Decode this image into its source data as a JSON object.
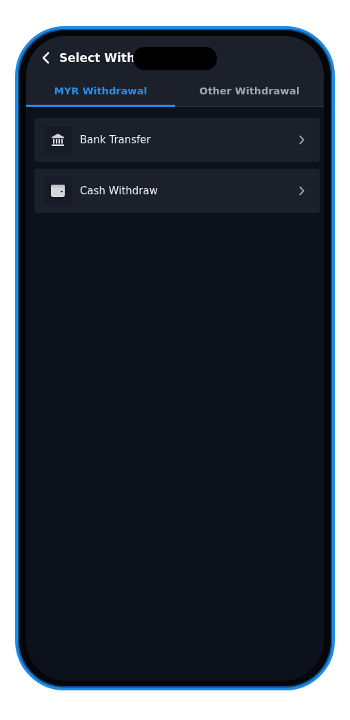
{
  "header": {
    "title": "Select With"
  },
  "tabs": [
    {
      "label": "MYR Withdrawal",
      "selected": true
    },
    {
      "label": "Other Withdrawal",
      "selected": false
    }
  ],
  "methods": [
    {
      "kind": "bank",
      "label": "Bank Transfer"
    },
    {
      "kind": "wallet",
      "label": "Cash Withdraw"
    }
  ]
}
